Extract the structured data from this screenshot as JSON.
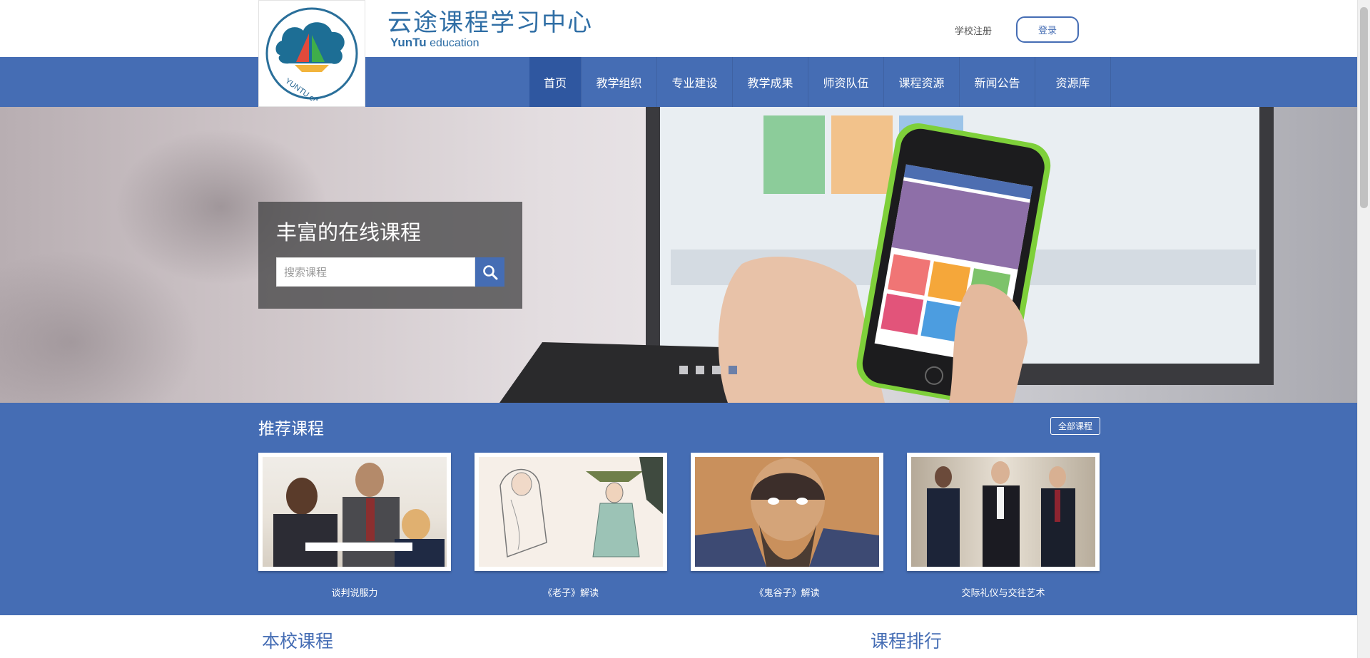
{
  "header": {
    "title": "云途课程学习中心",
    "subtitle_bold": "YunTu",
    "subtitle": "education",
    "logo_text": "YUNTU education",
    "register_label": "学校注册",
    "login_label": "登录"
  },
  "nav": {
    "items": [
      {
        "label": "首页",
        "active": true
      },
      {
        "label": "教学组织"
      },
      {
        "label": "专业建设"
      },
      {
        "label": "教学成果"
      },
      {
        "label": "师资队伍"
      },
      {
        "label": "课程资源"
      },
      {
        "label": "新闻公告"
      },
      {
        "label": "资源库"
      }
    ]
  },
  "hero": {
    "heading": "丰富的在线课程",
    "search_placeholder": "搜索课程",
    "slide_count": 4,
    "active_slide": 4
  },
  "recommended": {
    "title": "推荐课程",
    "all_label": "全部课程",
    "courses": [
      {
        "name": "谈判说服力"
      },
      {
        "name": "《老子》解读"
      },
      {
        "name": "《鬼谷子》解读"
      },
      {
        "name": "交际礼仪与交往艺术"
      }
    ]
  },
  "sections": {
    "school_courses": "本校课程",
    "ranking": "课程排行"
  },
  "colors": {
    "primary": "#456db4",
    "nav_active": "#2f57a0",
    "title_blue": "#2f6ea5"
  }
}
